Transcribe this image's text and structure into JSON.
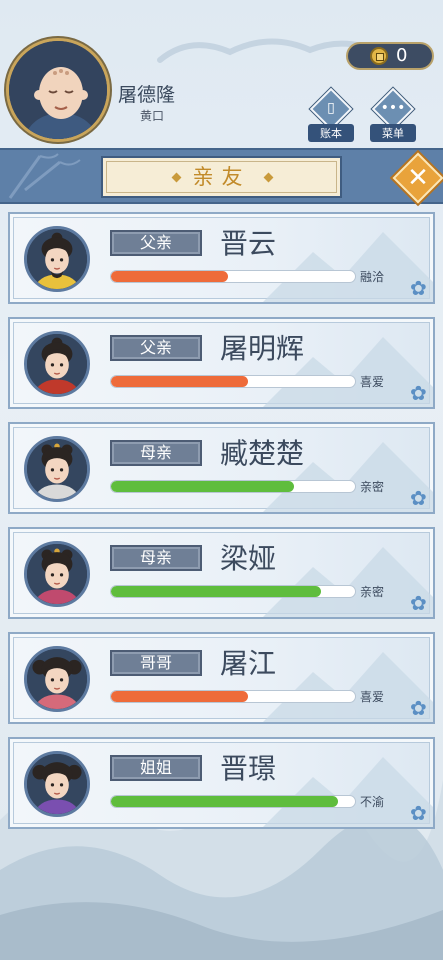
{
  "player": {
    "name": "屠德隆",
    "location": "黄口"
  },
  "currency": {
    "value": "0"
  },
  "top_buttons": [
    {
      "label": "账本"
    },
    {
      "label": "菜单",
      "glyph": "•••"
    }
  ],
  "banner": {
    "title": "亲友"
  },
  "close": {
    "glyph": "✕"
  },
  "bar_colors": {
    "orange": "#ee6b3a",
    "green": "#5fbd3d"
  },
  "relatives": [
    {
      "relation": "父亲",
      "name": "晋云",
      "mood": "融洽",
      "level": 0.48,
      "color": "orange"
    },
    {
      "relation": "父亲",
      "name": "屠明辉",
      "mood": "喜爱",
      "level": 0.56,
      "color": "orange"
    },
    {
      "relation": "母亲",
      "name": "臧楚楚",
      "mood": "亲密",
      "level": 0.75,
      "color": "green"
    },
    {
      "relation": "母亲",
      "name": "梁娅",
      "mood": "亲密",
      "level": 0.86,
      "color": "green"
    },
    {
      "relation": "哥哥",
      "name": "屠江",
      "mood": "喜爱",
      "level": 0.56,
      "color": "orange"
    },
    {
      "relation": "姐姐",
      "name": "晋璟",
      "mood": "不渝",
      "level": 0.93,
      "color": "green"
    }
  ]
}
